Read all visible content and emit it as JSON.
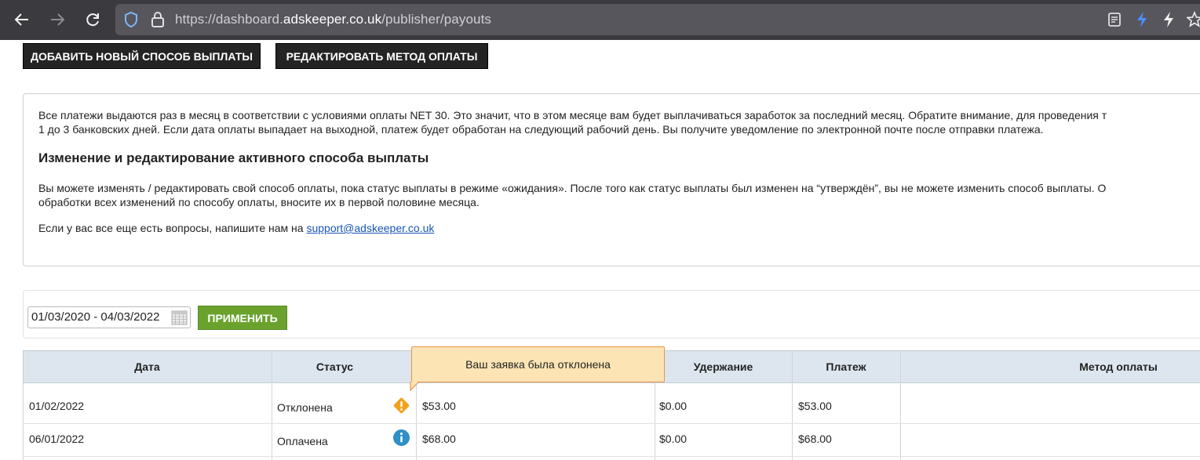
{
  "browser": {
    "url_prefix": "https://dashboard.",
    "url_domain": "adskeeper.co.uk",
    "url_path": "/publisher/payouts"
  },
  "actions": {
    "add_method_label": "ДОБАВИТЬ НОВЫЙ СПОСОБ ВЫПЛАТЫ",
    "edit_method_label": "РЕДАКТИРОВАТЬ МЕТОД ОПЛАТЫ"
  },
  "info": {
    "line1": "Все платежи выдаются раз в месяц в соответствии с условиями оплаты NET 30. Это значит, что в этом месяце вам будет выплачиваться заработок за последний месяц. Обратите внимание, для проведения т",
    "line2": "1 до 3 банковских дней. Если дата оплаты выпадает на выходной, платеж будет обработан на следующий рабочий день. Вы получите уведомление по электронной почте после отправки платежа.",
    "heading": "Изменение и редактирование активного способа выплаты",
    "line3": "Вы можете изменять / редактировать свой способ оплаты, пока статус выплаты в режиме «ожидания». После того как статус выплаты был изменен на “утверждён”, вы не можете изменить способ выплаты. О",
    "line4": "обработки всех изменений по способу оплаты, вносите их в первой половине месяца.",
    "contact_prefix": "Если у вас все еще есть вопросы, напишите нам на",
    "contact_email": "support@adskeeper.co.uk"
  },
  "filter": {
    "date_range": "01/03/2020 - 04/03/2022",
    "apply_label": "ПРИМЕНИТЬ"
  },
  "table": {
    "headers": {
      "date": "Дата",
      "status": "Статус",
      "hold": "Удержание",
      "payment": "Платеж",
      "method": "Метод оплаты"
    },
    "rows": [
      {
        "date": "01/02/2022",
        "status": "Отклонена",
        "status_icon": "warning-icon",
        "amount": "$53.00",
        "hold": "$0.00",
        "payment": "$53.00",
        "method": ""
      },
      {
        "date": "06/01/2022",
        "status": "Оплачена",
        "status_icon": "info-icon",
        "amount": "$68.00",
        "hold": "$0.00",
        "payment": "$68.00",
        "method": ""
      }
    ]
  },
  "tooltip": {
    "text": "Ваш заявка была отклонена"
  },
  "colors": {
    "apply_button": "#6aa22d",
    "header_bg": "#dde6ee",
    "warning": "#f2a21c",
    "info": "#2f8fc7",
    "tooltip_bg": "#fde4b4",
    "tooltip_border": "#e8944a"
  }
}
